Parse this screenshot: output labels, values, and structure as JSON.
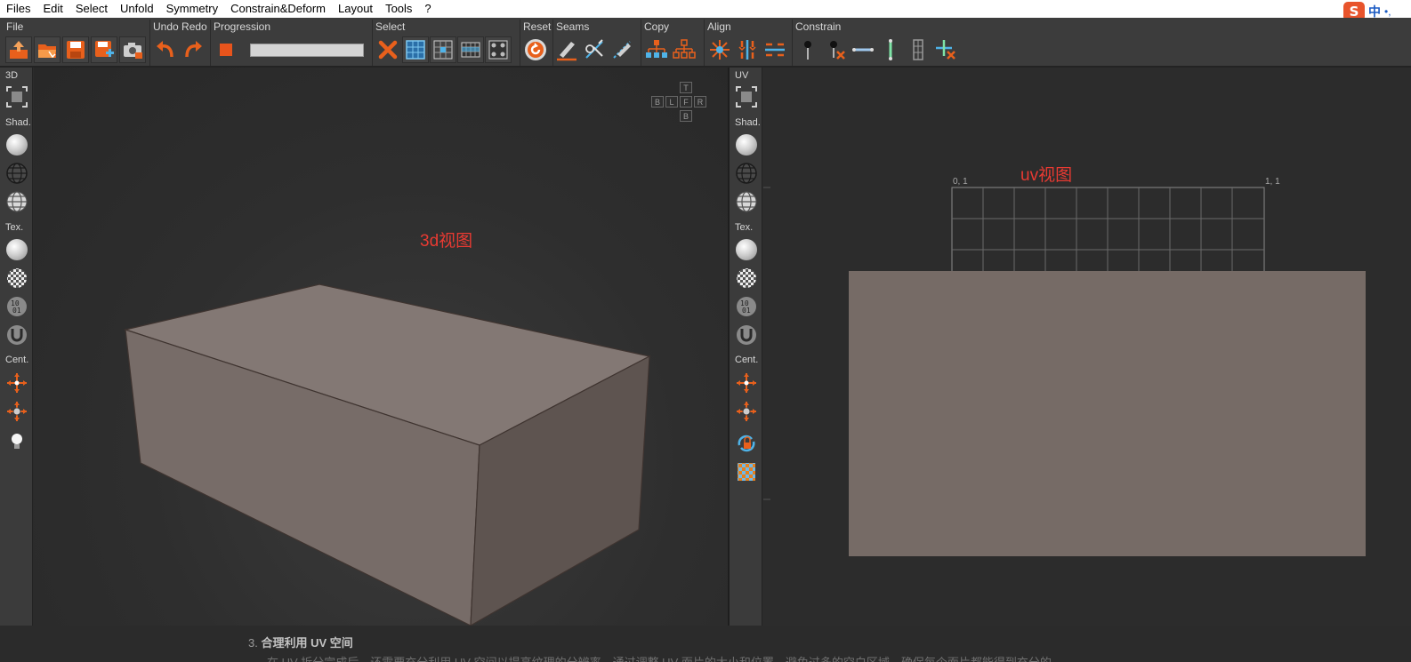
{
  "menubar": {
    "items": [
      "Files",
      "Edit",
      "Select",
      "Unfold",
      "Symmetry",
      "Constrain&Deform",
      "Layout",
      "Tools",
      "?"
    ]
  },
  "ime": {
    "logo": "S",
    "mode": "中",
    "dot": "•,"
  },
  "toolbar": {
    "groups": {
      "file": "File",
      "undoredo": "Undo Redo",
      "progression": "Progression",
      "select": "Select",
      "reset": "Reset",
      "seams": "Seams",
      "copy": "Copy",
      "align": "Align",
      "constrain": "Constrain"
    },
    "progress_value": 0
  },
  "panel3d": {
    "title": "3D",
    "shading": "Shad.",
    "texture": "Tex.",
    "center": "Cent."
  },
  "paneluv": {
    "title": "UV",
    "shading": "Shad.",
    "texture": "Tex.",
    "center": "Cent."
  },
  "view3d": {
    "annotation": "3d视图",
    "navcube": {
      "top": "T",
      "back": "B",
      "left": "L",
      "front": "F",
      "right": "R",
      "bottom": "B"
    }
  },
  "viewuv": {
    "annotation": "uv视图",
    "corner_tl": "0, 1",
    "corner_tr": "1, 1",
    "ruler_1": "1",
    "ruler_0": "0"
  },
  "doc": {
    "heading_num": "3.",
    "heading": "合理利用 UV 空间",
    "paragraph": "在 UV 拆分完成后，还需要充分利用 UV 空间以提高纹理的分辨率。通过调整 UV 面片的大小和位置，避免过多的空白区域，确保每个面片都能得到充分的"
  },
  "colors": {
    "accent": "#e8601c",
    "annotation": "#e83a32",
    "mesh_face": "#7a6e68",
    "uv_island": "#766b66"
  }
}
